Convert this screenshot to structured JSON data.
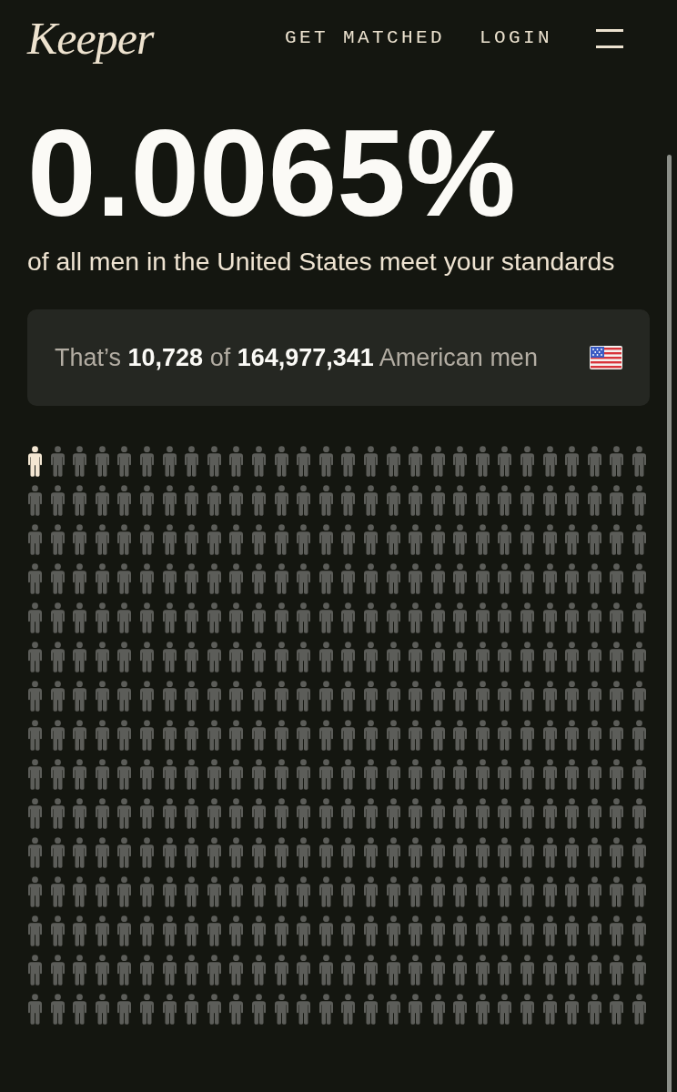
{
  "header": {
    "logo": "Keeper",
    "nav_links": [
      "GET MATCHED",
      "LOGIN"
    ]
  },
  "headline": {
    "percentage": "0.0065%",
    "caption": "of all men in the United States meet your standards"
  },
  "stat_card": {
    "text": "That’s **10,728** of **164,977,341** American men"
  },
  "people_grid": {
    "rows": [
      {
        "highlighted": [
          true,
          false,
          false,
          false,
          false,
          false,
          false,
          false,
          false,
          false,
          false,
          false,
          false,
          false,
          false,
          false,
          false,
          false,
          false,
          false,
          false,
          false,
          false,
          false,
          false,
          false,
          false,
          false
        ]
      },
      {
        "highlighted": [
          false,
          false,
          false,
          false,
          false,
          false,
          false,
          false,
          false,
          false,
          false,
          false,
          false,
          false,
          false,
          false,
          false,
          false,
          false,
          false,
          false,
          false,
          false,
          false,
          false,
          false,
          false,
          false
        ]
      },
      {
        "highlighted": [
          false,
          false,
          false,
          false,
          false,
          false,
          false,
          false,
          false,
          false,
          false,
          false,
          false,
          false,
          false,
          false,
          false,
          false,
          false,
          false,
          false,
          false,
          false,
          false,
          false,
          false,
          false,
          false
        ]
      },
      {
        "highlighted": [
          false,
          false,
          false,
          false,
          false,
          false,
          false,
          false,
          false,
          false,
          false,
          false,
          false,
          false,
          false,
          false,
          false,
          false,
          false,
          false,
          false,
          false,
          false,
          false,
          false,
          false,
          false,
          false
        ]
      },
      {
        "highlighted": [
          false,
          false,
          false,
          false,
          false,
          false,
          false,
          false,
          false,
          false,
          false,
          false,
          false,
          false,
          false,
          false,
          false,
          false,
          false,
          false,
          false,
          false,
          false,
          false,
          false,
          false,
          false,
          false
        ]
      },
      {
        "highlighted": [
          false,
          false,
          false,
          false,
          false,
          false,
          false,
          false,
          false,
          false,
          false,
          false,
          false,
          false,
          false,
          false,
          false,
          false,
          false,
          false,
          false,
          false,
          false,
          false,
          false,
          false,
          false,
          false
        ]
      },
      {
        "highlighted": [
          false,
          false,
          false,
          false,
          false,
          false,
          false,
          false,
          false,
          false,
          false,
          false,
          false,
          false,
          false,
          false,
          false,
          false,
          false,
          false,
          false,
          false,
          false,
          false,
          false,
          false,
          false,
          false
        ]
      },
      {
        "highlighted": [
          false,
          false,
          false,
          false,
          false,
          false,
          false,
          false,
          false,
          false,
          false,
          false,
          false,
          false,
          false,
          false,
          false,
          false,
          false,
          false,
          false,
          false,
          false,
          false,
          false,
          false,
          false,
          false
        ]
      },
      {
        "highlighted": [
          false,
          false,
          false,
          false,
          false,
          false,
          false,
          false,
          false,
          false,
          false,
          false,
          false,
          false,
          false,
          false,
          false,
          false,
          false,
          false,
          false,
          false,
          false,
          false,
          false,
          false,
          false,
          false
        ]
      },
      {
        "highlighted": [
          false,
          false,
          false,
          false,
          false,
          false,
          false,
          false,
          false,
          false,
          false,
          false,
          false,
          false,
          false,
          false,
          false,
          false,
          false,
          false,
          false,
          false,
          false,
          false,
          false,
          false,
          false,
          false
        ]
      },
      {
        "highlighted": [
          false,
          false,
          false,
          false,
          false,
          false,
          false,
          false,
          false,
          false,
          false,
          false,
          false,
          false,
          false,
          false,
          false,
          false,
          false,
          false,
          false,
          false,
          false,
          false,
          false,
          false,
          false,
          false
        ]
      },
      {
        "highlighted": [
          false,
          false,
          false,
          false,
          false,
          false,
          false,
          false,
          false,
          false,
          false,
          false,
          false,
          false,
          false,
          false,
          false,
          false,
          false,
          false,
          false,
          false,
          false,
          false,
          false,
          false,
          false,
          false
        ]
      },
      {
        "highlighted": [
          false,
          false,
          false,
          false,
          false,
          false,
          false,
          false,
          false,
          false,
          false,
          false,
          false,
          false,
          false,
          false,
          false,
          false,
          false,
          false,
          false,
          false,
          false,
          false,
          false,
          false,
          false,
          false
        ]
      },
      {
        "highlighted": [
          false,
          false,
          false,
          false,
          false,
          false,
          false,
          false,
          false,
          false,
          false,
          false,
          false,
          false,
          false,
          false,
          false,
          false,
          false,
          false,
          false,
          false,
          false,
          false,
          false,
          false,
          false,
          false
        ]
      },
      {
        "highlighted": [
          false,
          false,
          false,
          false,
          false,
          false,
          false,
          false,
          false,
          false,
          false,
          false,
          false,
          false,
          false,
          false,
          false,
          false,
          false,
          false,
          false,
          false,
          false,
          false,
          false,
          false,
          false,
          false
        ]
      }
    ]
  }
}
